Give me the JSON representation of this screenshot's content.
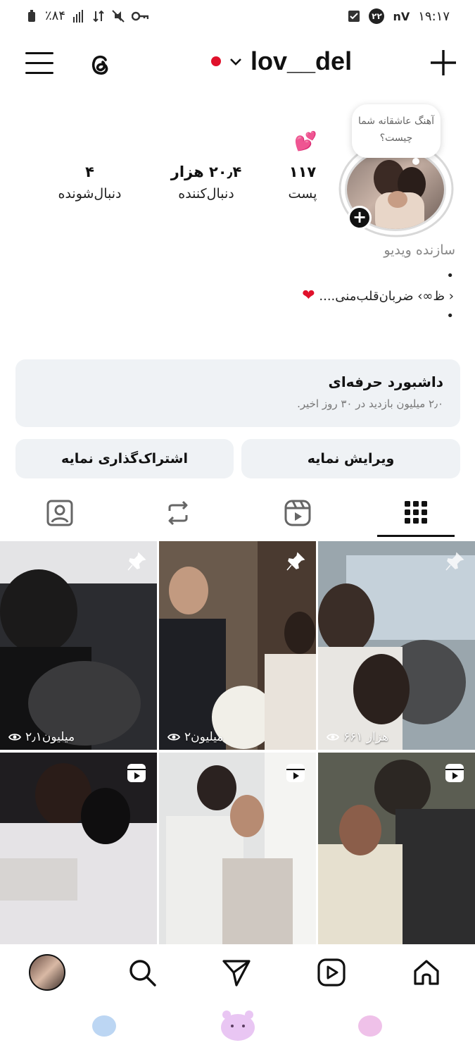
{
  "status_bar": {
    "time": "۱۹:۱۷",
    "battery": "٪۸۴",
    "carrier": "۲۲",
    "network_speed": "nV"
  },
  "header": {
    "username": "lov__del",
    "icons": [
      "menu-icon",
      "threads-icon",
      "chevron-down-icon",
      "plus-icon"
    ]
  },
  "profile": {
    "note": "آهنگ عاشقانه شما چیست؟",
    "stats": {
      "posts": {
        "value": "۱۱۷",
        "label": "پست"
      },
      "followers": {
        "value": "۲۰٫۴ هزار",
        "label": "دنبال‌کننده"
      },
      "following": {
        "value": "۴",
        "label": "دنبال‌شونده"
      }
    },
    "category": "سازنده ویدیو",
    "bio_line1": "•",
    "bio_line2": "‹ ظ∞› ضربان‌قلب‌منی....",
    "bio_heart": "❤",
    "bio_line3": "•"
  },
  "dashboard": {
    "title": "داشبورد حرفه‌ای",
    "subtitle": "۲٫۰ میلیون بازدید در ۳۰ روز اخیر."
  },
  "actions": {
    "edit_profile": "ویرایش نمایه",
    "share_profile": "اشتراک‌گذاری نمایه"
  },
  "grid": {
    "posts": [
      {
        "views": "۶۶۱ هزار",
        "type": "pinned"
      },
      {
        "views": "۲میلیون",
        "type": "pinned"
      },
      {
        "views": "۲٫۱میلیون",
        "type": "pinned"
      },
      {
        "views": "",
        "type": "reel"
      },
      {
        "views": "",
        "type": "reel"
      },
      {
        "views": "",
        "type": "reel"
      }
    ]
  },
  "colors": {
    "accent_red": "#e0112b",
    "panel_bg": "#eff2f5"
  }
}
